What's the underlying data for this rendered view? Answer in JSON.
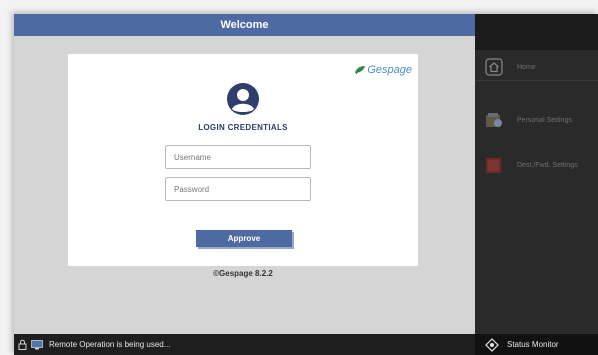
{
  "title_bar": {
    "title": "Welcome"
  },
  "login": {
    "logo_text": "Gespage",
    "heading": "LOGIN CREDENTIALS",
    "username_placeholder": "Username",
    "password_placeholder": "Password",
    "approve_label": "Approve",
    "copyright": "©Gespage 8.2.2"
  },
  "sidebar": {
    "items": [
      {
        "label": "Home",
        "icon": "home-icon"
      },
      {
        "label": "Personal Settings",
        "icon": "personal-settings-icon"
      },
      {
        "label": "Dest./Fwd. Settings",
        "icon": "dest-fwd-settings-icon"
      }
    ]
  },
  "status_bar": {
    "message": "Remote Operation is being used...",
    "monitor_label": "Status Monitor"
  },
  "colors": {
    "title_bar": "#4e6aa3",
    "sidebar": "#2a2a2a",
    "status_bar": "#1e1e1e"
  }
}
